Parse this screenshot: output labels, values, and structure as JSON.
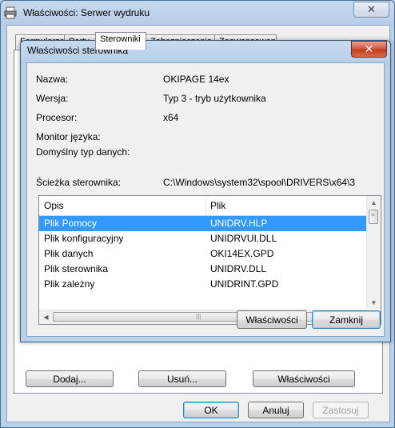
{
  "background_window": {
    "title": "Właściwości: Serwer wydruku",
    "close_glyph": "✕",
    "tabs": [
      {
        "label": "Formularze"
      },
      {
        "label": "Porty"
      },
      {
        "label": "Sterowniki",
        "active": true
      },
      {
        "label": "Zabezpieczenia"
      },
      {
        "label": "Zaawansowane"
      }
    ],
    "buttons": {
      "add": "Dodaj...",
      "remove": "Usuń...",
      "properties": "Właściwości",
      "ok": "OK",
      "cancel": "Anuluj",
      "apply": "Zastosuj"
    }
  },
  "dialog": {
    "title": "Właściwości sterownika",
    "close_glyph": "✕",
    "fields": {
      "name_label": "Nazwa:",
      "name_value": "OKIPAGE 14ex",
      "version_label": "Wersja:",
      "version_value": "Typ 3 - tryb użytkownika",
      "processor_label": "Procesor:",
      "processor_value": "x64",
      "language_monitor_label": "Monitor języka:",
      "default_datatype_label": "Domyślny typ danych:",
      "driver_path_label": "Ścieżka sterownika:",
      "driver_path_value": "C:\\Windows\\system32\\spool\\DRIVERS\\x64\\3"
    },
    "list": {
      "columns": [
        "Opis",
        "Plik"
      ],
      "rows": [
        {
          "desc": "Plik Pomocy",
          "file": "UNIDRV.HLP",
          "selected": true
        },
        {
          "desc": "Plik konfiguracyjny",
          "file": "UNIDRVUI.DLL"
        },
        {
          "desc": "Plik danych",
          "file": "OKI14EX.GPD"
        },
        {
          "desc": "Plik sterownika",
          "file": "UNIDRV.DLL"
        },
        {
          "desc": "Plik zależny",
          "file": "UNIDRINT.GPD"
        }
      ]
    },
    "buttons": {
      "properties": "Właściwości",
      "close": "Zamknij"
    },
    "icons": {
      "scroll_up": "▲",
      "scroll_down": "▼",
      "scroll_left": "◀",
      "scroll_right": "▶",
      "grip_v": "≡",
      "grip_h": "|||"
    }
  }
}
